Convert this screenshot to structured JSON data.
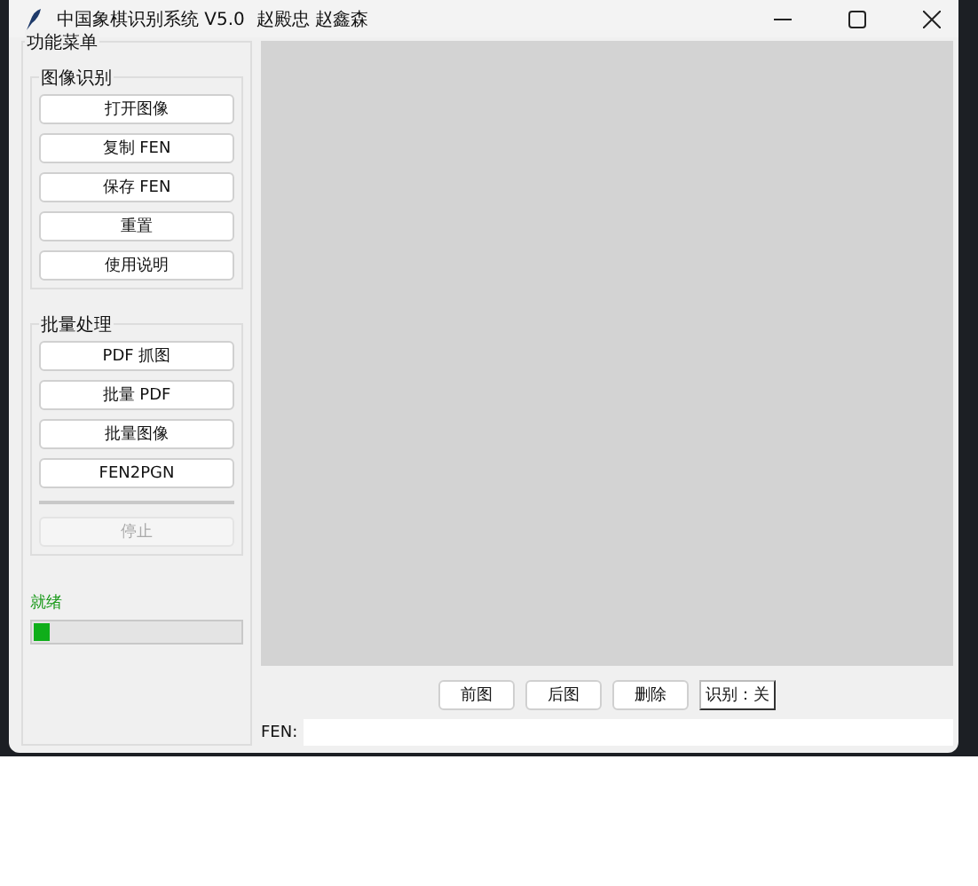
{
  "window": {
    "title": "中国象棋识别系统 V5.0  赵殿忠 赵鑫森"
  },
  "menu": {
    "title": "功能菜单",
    "groups": [
      {
        "title": "图像识别",
        "buttons": [
          {
            "label": "打开图像",
            "disabled": false
          },
          {
            "label": "复制 FEN",
            "disabled": false
          },
          {
            "label": "保存 FEN",
            "disabled": false
          },
          {
            "label": "重置",
            "disabled": false
          },
          {
            "label": "使用说明",
            "disabled": false
          }
        ]
      },
      {
        "title": "批量处理",
        "buttons": [
          {
            "label": "PDF 抓图",
            "disabled": false
          },
          {
            "label": "批量 PDF",
            "disabled": false
          },
          {
            "label": "批量图像",
            "disabled": false
          },
          {
            "label": "FEN2PGN",
            "disabled": false
          },
          {
            "kind": "separator"
          },
          {
            "label": "停止",
            "disabled": true
          }
        ]
      }
    ]
  },
  "status": {
    "text": "就绪",
    "level": 0.08
  },
  "nav_buttons": [
    {
      "label": "前图",
      "kind": "button"
    },
    {
      "label": "后图",
      "kind": "button"
    },
    {
      "label": "删除",
      "kind": "button"
    },
    {
      "label": "识别：关",
      "kind": "toggle"
    }
  ],
  "fen": {
    "label": "FEN:"
  }
}
